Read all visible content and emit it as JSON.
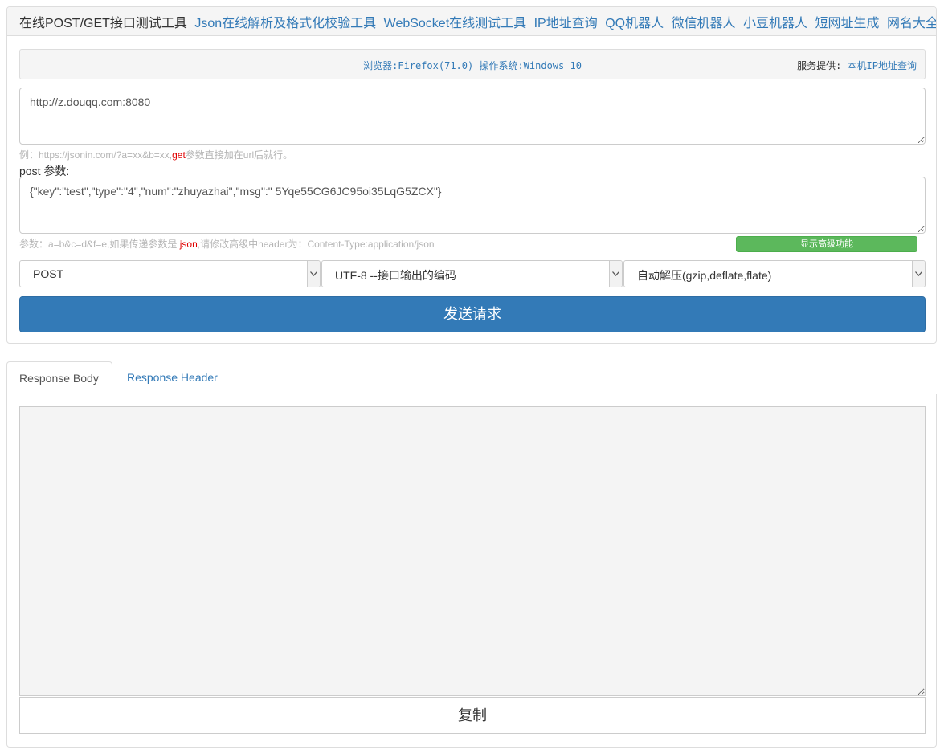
{
  "header": {
    "title": "在线POST/GET接口测试工具",
    "nav": [
      "Json在线解析及格式化校验工具",
      "WebSocket在线测试工具",
      "IP地址查询",
      "QQ机器人",
      "微信机器人",
      "小豆机器人",
      "短网址生成",
      "网名大全"
    ]
  },
  "info": {
    "browser_label": "浏览器:",
    "browser": "Firefox(71.0)",
    "os_label": " 操作系统:",
    "os": "Windows 10",
    "service_label": "服务提供: ",
    "service_link": "本机IP地址查询"
  },
  "request": {
    "url_value": "http://z.douqq.com:8080",
    "url_hint_prefix": "例：https://jsonin.com/?a=xx&b=xx,",
    "url_hint_red": "get",
    "url_hint_suffix": "参数直接加在url后就行。",
    "post_label": "post 参数:",
    "post_value": "{\"key\":\"test\",\"type\":\"4\",\"num\":\"zhuyazhai\",\"msg\":\" 5Yqe55CG6JC95oi35LqG5ZCX\"}",
    "post_hint_prefix": "参数：a=b&c=d&f=e,如果传递参数是 ",
    "post_hint_red": "json",
    "post_hint_suffix": ",请修改高级中header为：Content-Type:application/json",
    "advanced_button": "显示高级功能",
    "method": "POST",
    "encoding": "UTF-8 --接口输出的编码",
    "decompress": "自动解压(gzip,deflate,flate)",
    "send_button": "发送请求"
  },
  "response": {
    "tabs": [
      "Response Body",
      "Response Header"
    ],
    "active_tab": "Response Body",
    "body": "",
    "copy_button": "复制"
  },
  "colors": {
    "link": "#337ab7",
    "primary_button": "#337ab7",
    "success_button": "#5cb85c",
    "hint_text": "#b5b5b5",
    "hint_highlight": "#e00000"
  }
}
